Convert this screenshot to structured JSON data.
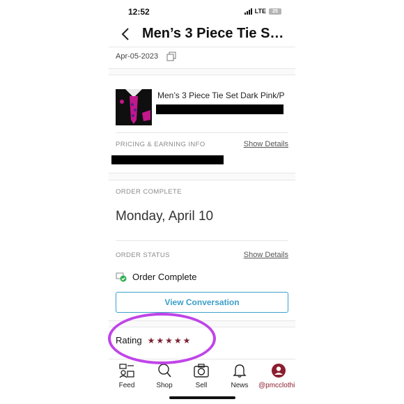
{
  "status_bar": {
    "time": "12:52",
    "network": "LTE",
    "battery": "25"
  },
  "header": {
    "title": "Men’s 3 Piece Tie S…"
  },
  "order": {
    "date": "Apr-05-2023"
  },
  "product": {
    "name": "Men’s 3 Piece Tie Set Dark Pink/P"
  },
  "pricing": {
    "label": "PRICING & EARNING INFO",
    "link": "Show Details"
  },
  "order_complete": {
    "label": "ORDER COMPLETE",
    "date": "Monday, April 10"
  },
  "order_status": {
    "label": "ORDER STATUS",
    "link": "Show Details",
    "value": "Order Complete"
  },
  "actions": {
    "view_conversation": "View Conversation"
  },
  "rating": {
    "label": "Rating",
    "stars": 5,
    "star_color": "#7d2133"
  },
  "tabs": [
    {
      "label": "Feed",
      "icon": "feed-icon"
    },
    {
      "label": "Shop",
      "icon": "search-icon"
    },
    {
      "label": "Sell",
      "icon": "camera-icon"
    },
    {
      "label": "News",
      "icon": "bell-icon"
    },
    {
      "label": "@pmcclothin",
      "icon": "avatar-icon"
    }
  ],
  "colors": {
    "accent": "#3b9fc8",
    "annotation": "#c044e8",
    "avatar": "#8b1e2e"
  }
}
